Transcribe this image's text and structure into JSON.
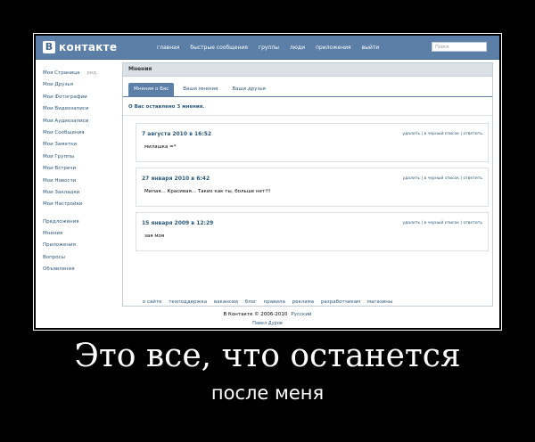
{
  "header": {
    "logo_letter": "В",
    "logo_text": "контакте",
    "nav": [
      "главная",
      "быстрые сообщения",
      "группы",
      "люди",
      "приложения",
      "выйти"
    ],
    "search_placeholder": "Поиск"
  },
  "sidebar": {
    "items": [
      {
        "label": "Моя Страница",
        "extra": "ред."
      },
      {
        "label": "Мои Друзья"
      },
      {
        "label": "Мои Фотографии"
      },
      {
        "label": "Мои Видеозаписи"
      },
      {
        "label": "Мои Аудиозаписи"
      },
      {
        "label": "Мои Сообщения"
      },
      {
        "label": "Мои Заметки"
      },
      {
        "label": "Мои Группы"
      },
      {
        "label": "Мои Встречи"
      },
      {
        "label": "Мои Новости"
      },
      {
        "label": "Мои Закладки"
      },
      {
        "label": "Мои Настройки"
      }
    ],
    "extra_items": [
      "Предложения",
      "Мнения",
      "Приложения",
      "Вопросы",
      "Объявления"
    ]
  },
  "main": {
    "title": "Мнения",
    "tabs": [
      "Мнения о Вас",
      "Ваши мнения",
      "Ваши друзья"
    ],
    "summary": "О Вас оставлено 3 мнения.",
    "opinions": [
      {
        "date": "7 августа 2010 в 16:52",
        "text": "милашка =*"
      },
      {
        "date": "27 января 2010 в 6:42",
        "text": "Милая... Красивая... Таких как ты, больше нет!!!"
      },
      {
        "date": "15 января 2009 в 12:29",
        "text": "зая моя"
      }
    ],
    "actions": "удалить | в черный список | ответить"
  },
  "footer": {
    "links": [
      "о сайте",
      "техподдержка",
      "вакансии",
      "блог",
      "правила",
      "реклама",
      "разработчикам",
      "магазины"
    ],
    "copyright": "В Контакте © 2006-2010",
    "language": "Русский",
    "author": "Павел Дуров"
  },
  "caption": {
    "title": "Это все, что останется",
    "subtitle": "после меня"
  }
}
